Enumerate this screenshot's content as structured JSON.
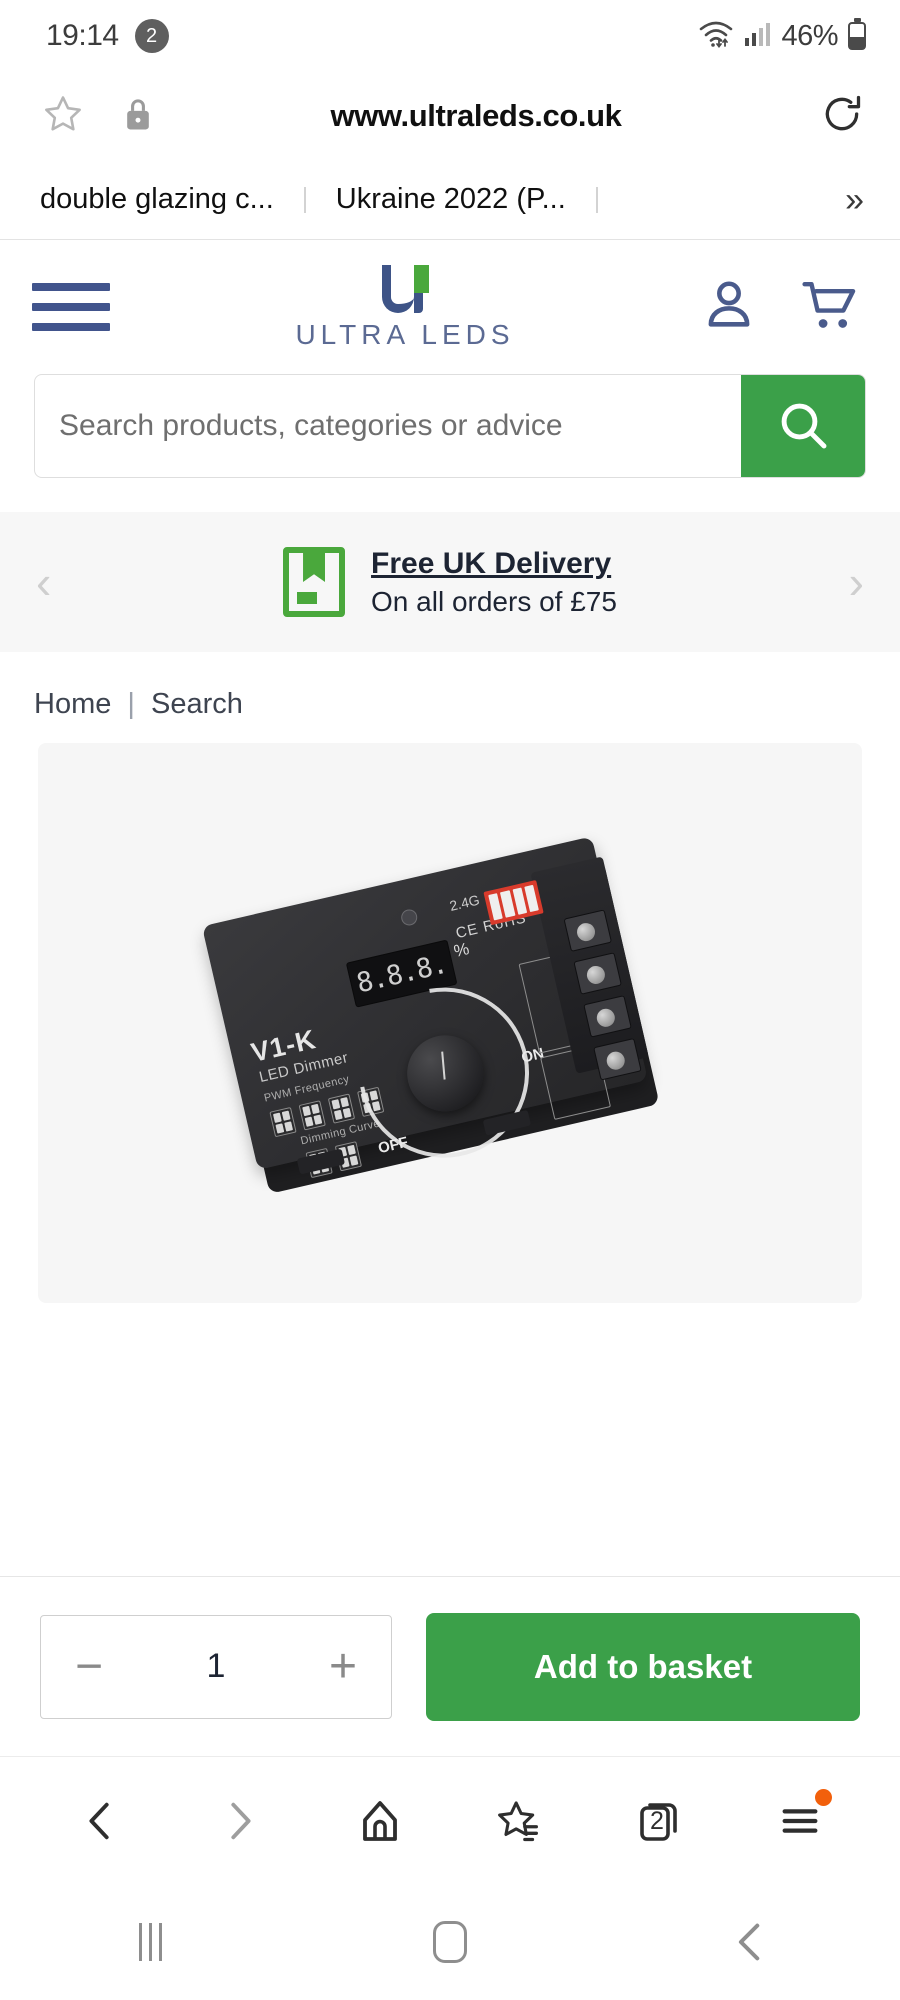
{
  "status_bar": {
    "time": "19:14",
    "notification_count": "2",
    "wifi_icon": "wifi-icon",
    "signal_icon": "signal-bars-icon",
    "battery_percent": "46%",
    "battery_icon": "battery-icon"
  },
  "url_bar": {
    "bookmark_icon": "star-outline-icon",
    "security_icon": "lock-icon",
    "url": "www.ultraleds.co.uk",
    "reload_icon": "reload-icon"
  },
  "tab_strip": {
    "tabs": [
      {
        "label": "double glazing c..."
      },
      {
        "label": "Ukraine 2022 (P..."
      }
    ],
    "more_label": "»"
  },
  "site_header": {
    "menu_icon": "hamburger-menu-icon",
    "logo_wordmark": "ULTRA LEDS",
    "logo_colors": {
      "navy": "#3e5487",
      "green": "#4aa83c"
    },
    "account_icon": "account-person-icon",
    "cart_icon": "shopping-cart-icon"
  },
  "search": {
    "value": "",
    "placeholder": "Search products, categories or advice",
    "button_icon": "search-magnifier-icon",
    "button_color": "#3ba049"
  },
  "banner": {
    "prev_label": "‹",
    "next_label": "›",
    "icon": "delivery-box-icon",
    "title": "Free UK Delivery",
    "subtitle": "On all orders of £75",
    "background": "#f7f7f7"
  },
  "breadcrumb": {
    "items": [
      {
        "label": "Home"
      },
      {
        "label": "Search"
      }
    ],
    "separator": "|"
  },
  "product": {
    "image_alt": "V1-K LED Dimmer rotary controller",
    "device": {
      "model": "V1-K",
      "subtitle": "LED Dimmer",
      "pwm_label": "PWM Frequency",
      "curve_label": "Dimming Curve",
      "display_value": "8.8.8.",
      "percent_symbol": "%",
      "knob_off_label": "OFF",
      "knob_on_label": "ON",
      "certs": "CE RoHS",
      "frequency_label": "2.4G"
    }
  },
  "buy_bar": {
    "decrement_label": "−",
    "quantity": "1",
    "increment_label": "+",
    "add_to_basket_label": "Add to basket",
    "button_color": "#3ba049"
  },
  "browser_bar": {
    "back_icon": "chevron-left-icon",
    "forward_icon": "chevron-right-icon",
    "home_icon": "home-icon",
    "bookmarks_icon": "star-list-icon",
    "tabs_icon": "tabs-icon",
    "tabs_count": "2",
    "menu_icon": "hamburger-menu-icon",
    "menu_badge_color": "#f2600c"
  },
  "android_nav": {
    "recents_icon": "recents-icon",
    "home_icon": "home-pill-icon",
    "back_icon": "back-chevron-icon"
  }
}
